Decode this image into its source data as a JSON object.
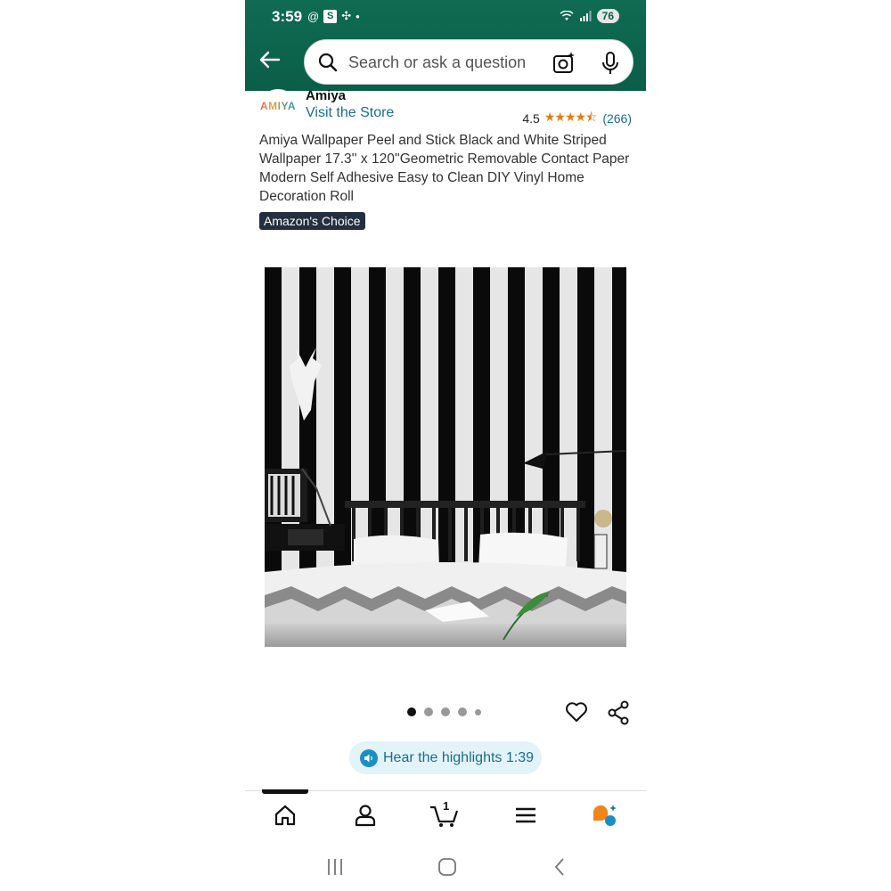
{
  "status_bar": {
    "time": "3:59",
    "battery": "76"
  },
  "search": {
    "placeholder": "Search or ask a question"
  },
  "brand": {
    "logo_text": "AMIYA",
    "name": "Amiya",
    "visit_store": "Visit the Store"
  },
  "rating": {
    "value": "4.5",
    "stars": "★★★★⯪",
    "count": "(266)"
  },
  "product": {
    "title": "Amiya Wallpaper Peel and Stick Black and White Striped Wallpaper 17.3'' x 120''Geometric Removable Contact Paper Modern Self Adhesive Easy to Clean DIY Vinyl Home Decoration Roll",
    "badge": "Amazon's Choice"
  },
  "gallery": {
    "image_count": 5,
    "active_index": 0
  },
  "highlights": {
    "label": "Hear the highlights 1:39"
  },
  "bottom_nav": {
    "cart_count": "1",
    "items": [
      "home",
      "account",
      "cart",
      "menu",
      "rufus"
    ]
  },
  "colors": {
    "header_green": "#0b5e48",
    "link": "#1a6e8a",
    "star": "#e57a14",
    "badge_bg": "#232f3e"
  }
}
